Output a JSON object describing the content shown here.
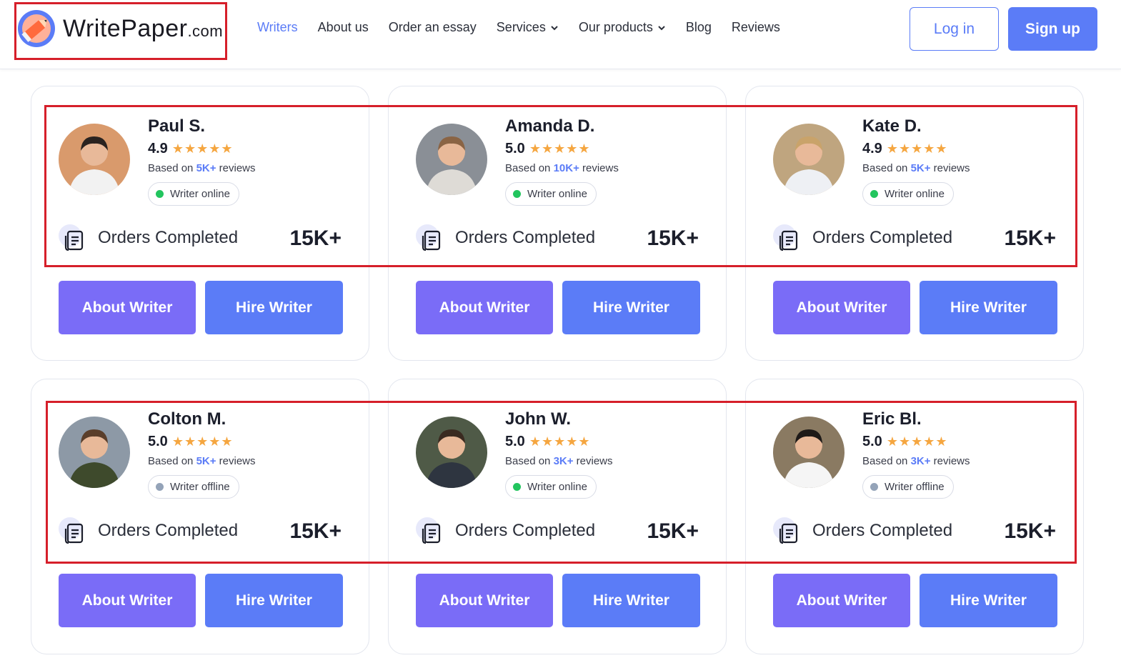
{
  "header": {
    "logo_main": "WritePaper",
    "logo_domain": ".com",
    "nav": [
      {
        "label": "Writers",
        "active": true
      },
      {
        "label": "About us"
      },
      {
        "label": "Order an essay"
      },
      {
        "label": "Services",
        "dropdown": true
      },
      {
        "label": "Our products",
        "dropdown": true
      },
      {
        "label": "Blog"
      },
      {
        "label": "Reviews"
      }
    ],
    "login_label": "Log in",
    "signup_label": "Sign up"
  },
  "writers": [
    {
      "name": "Paul S.",
      "rating": "4.9",
      "based_prefix": "Based on",
      "reviews_count": "5K+",
      "reviews_suffix": "reviews",
      "status": "Writer online",
      "online": true,
      "orders_label": "Orders Completed",
      "orders_value": "15K+",
      "about_label": "About Writer",
      "hire_label": "Hire Writer"
    },
    {
      "name": "Amanda D.",
      "rating": "5.0",
      "based_prefix": "Based on",
      "reviews_count": "10K+",
      "reviews_suffix": "reviews",
      "status": "Writer online",
      "online": true,
      "orders_label": "Orders Completed",
      "orders_value": "15K+",
      "about_label": "About Writer",
      "hire_label": "Hire Writer"
    },
    {
      "name": "Kate D.",
      "rating": "4.9",
      "based_prefix": "Based on",
      "reviews_count": "5K+",
      "reviews_suffix": "reviews",
      "status": "Writer online",
      "online": true,
      "orders_label": "Orders Completed",
      "orders_value": "15K+",
      "about_label": "About Writer",
      "hire_label": "Hire Writer"
    },
    {
      "name": "Colton M.",
      "rating": "5.0",
      "based_prefix": "Based on",
      "reviews_count": "5K+",
      "reviews_suffix": "reviews",
      "status": "Writer offline",
      "online": false,
      "orders_label": "Orders Completed",
      "orders_value": "15K+",
      "about_label": "About Writer",
      "hire_label": "Hire Writer"
    },
    {
      "name": "John W.",
      "rating": "5.0",
      "based_prefix": "Based on",
      "reviews_count": "3K+",
      "reviews_suffix": "reviews",
      "status": "Writer online",
      "online": true,
      "orders_label": "Orders Completed",
      "orders_value": "15K+",
      "about_label": "About Writer",
      "hire_label": "Hire Writer"
    },
    {
      "name": "Eric Bl.",
      "rating": "5.0",
      "based_prefix": "Based on",
      "reviews_count": "3K+",
      "reviews_suffix": "reviews",
      "status": "Writer offline",
      "online": false,
      "orders_label": "Orders Completed",
      "orders_value": "15K+",
      "about_label": "About Writer",
      "hire_label": "Hire Writer"
    }
  ],
  "stars": "★★★★★",
  "colors": {
    "accent": "#5b7cf7",
    "about_button": "#7a6cf7",
    "star": "#f5a640",
    "online": "#22c55e",
    "offline": "#94a3b8",
    "highlight": "#d61f2a"
  }
}
